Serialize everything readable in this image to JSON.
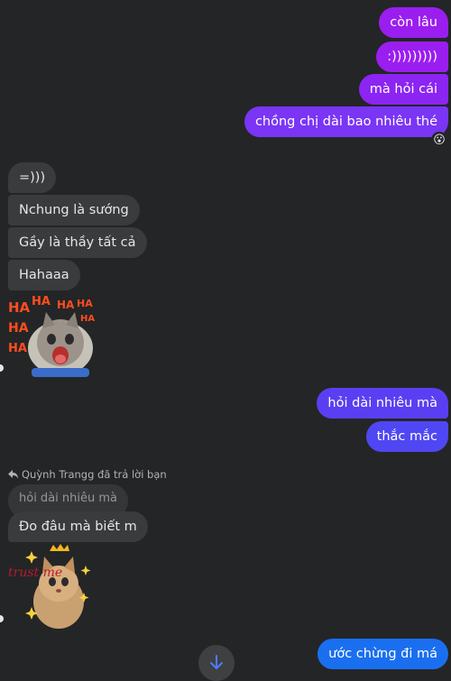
{
  "colors": {
    "background": "#242526",
    "incoming_bubble": "#3a3b3c",
    "outgoing_purple": "#9b1ef0",
    "outgoing_violet": "#7a35f5",
    "outgoing_indigo": "#5a3ff2",
    "outgoing_blue": "#2f62f2",
    "outgoing_blue2": "#1a6ff0"
  },
  "messages": {
    "out_1": "còn lâu",
    "out_2": ":)))))))))",
    "out_3": "mà hỏi cái",
    "out_4": "chồng chị dài bao nhiêu thé",
    "out_4_reaction": "😮",
    "in_1": "=)))",
    "in_2": "Nchung là sướng",
    "in_3": "Gầy là thầy tất cả",
    "in_4": "Hahaaa",
    "out_5": "hỏi dài nhiêu mà",
    "out_6": "thắc mắc",
    "reply_label": "Quỳnh Trangg đã trả lời bạn",
    "reply_quote": "hỏi dài nhiêu mà",
    "in_5": "Đo đâu mà biết m",
    "out_7": "ước chừng đi má"
  },
  "stickers": {
    "haha_text": "HA",
    "trust_text": "trust me"
  },
  "icons": {
    "reply": "reply-arrow-icon",
    "scroll": "arrow-down-icon"
  }
}
